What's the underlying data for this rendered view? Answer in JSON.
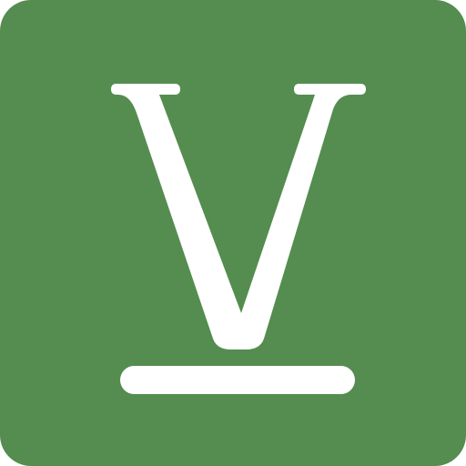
{
  "icon": {
    "name": "v-logo-icon",
    "letter": "V",
    "background_color": "#548D4F",
    "foreground_color": "#FFFFFF"
  }
}
